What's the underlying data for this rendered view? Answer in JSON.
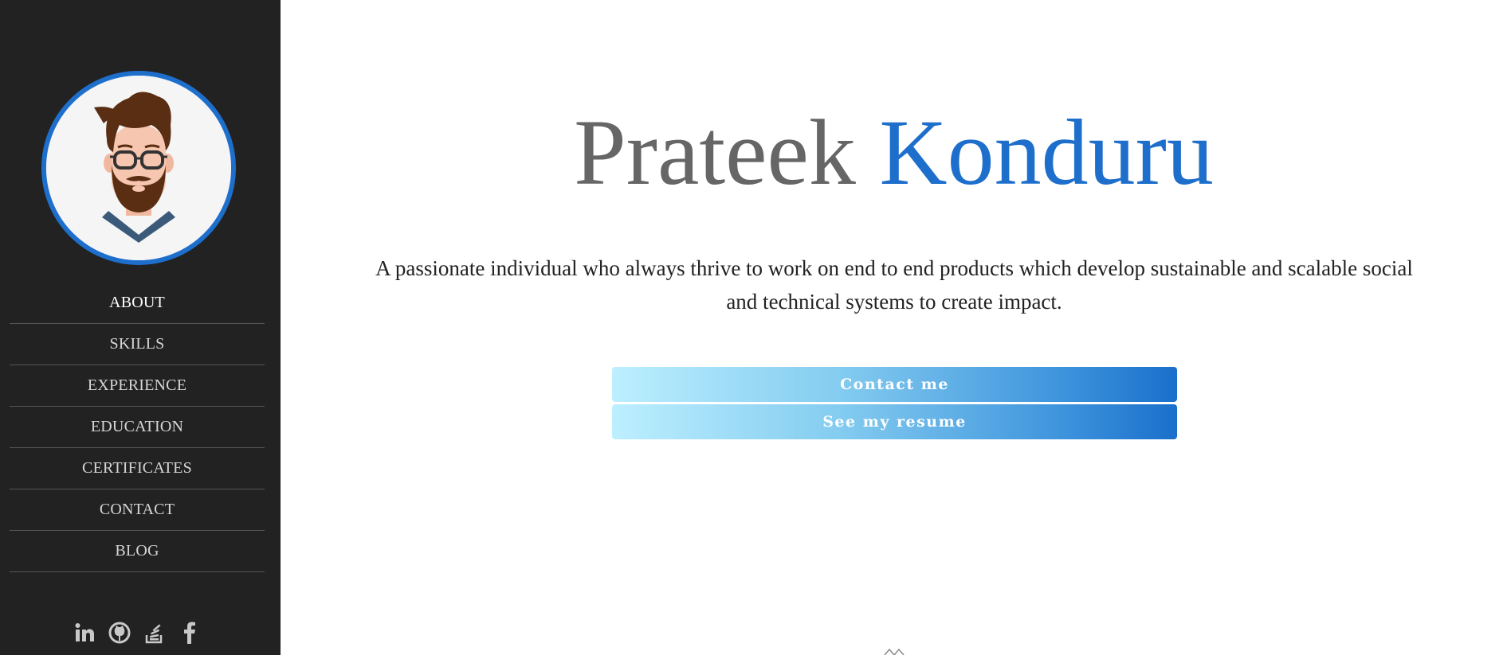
{
  "sidebar": {
    "avatar_alt": "avatar",
    "nav": [
      {
        "label": "ABOUT",
        "active": true
      },
      {
        "label": "SKILLS"
      },
      {
        "label": "EXPERIENCE"
      },
      {
        "label": "EDUCATION"
      },
      {
        "label": "CERTIFICATES"
      },
      {
        "label": "CONTACT"
      },
      {
        "label": "BLOG"
      }
    ],
    "social": [
      "linkedin-icon",
      "github-icon",
      "stackoverflow-icon",
      "facebook-icon"
    ]
  },
  "hero": {
    "first_name": "Prateek",
    "last_name": "Konduru",
    "tagline": "A passionate individual who always thrive to work on end to end products which develop sustainable and scalable social and technical systems to create impact.",
    "contact_label": "Contact me",
    "resume_label": "See my resume"
  },
  "colors": {
    "sidebar_bg": "#222222",
    "accent": "#1e6fcc",
    "name_gray": "#666666"
  }
}
